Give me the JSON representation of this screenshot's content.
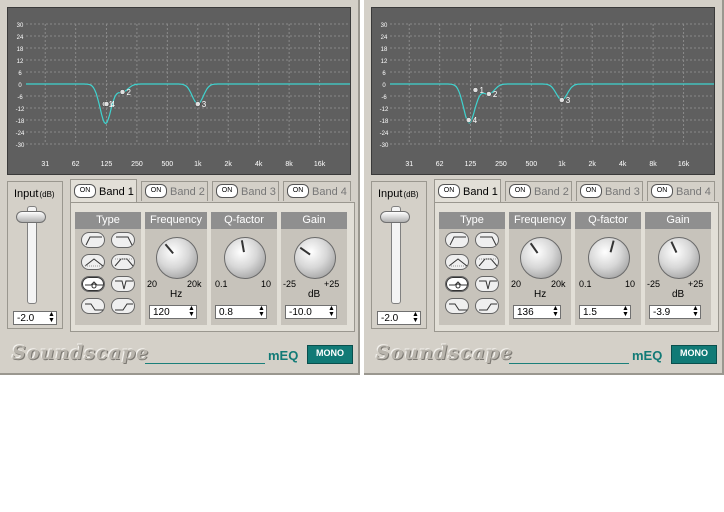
{
  "colors": {
    "accent": "#117a76",
    "curve": "#3fd3cf",
    "graph_bg": "#5f5f5f",
    "grid": "#8a8a8a"
  },
  "graph_scale": {
    "db_ticks": [
      "30",
      "24",
      "18",
      "12",
      "6",
      "0",
      "-6",
      "-12",
      "-18",
      "-24",
      "-30"
    ],
    "freq_ticks": [
      "31",
      "62",
      "125",
      "250",
      "500",
      "1k",
      "2k",
      "4k",
      "8k",
      "16k"
    ]
  },
  "panels": [
    {
      "input": {
        "label": "Input",
        "unit": "(dB)",
        "value": "-2.0"
      },
      "tabs": [
        {
          "on": "ON",
          "label": "Band 1",
          "active": true
        },
        {
          "on": "ON",
          "label": "Band 2",
          "active": false
        },
        {
          "on": "ON",
          "label": "Band 3",
          "active": false
        },
        {
          "on": "ON",
          "label": "Band 4",
          "active": false
        }
      ],
      "columns": {
        "type": "Type",
        "frequency": "Frequency",
        "q": "Q-factor",
        "gain": "Gain"
      },
      "frequency": {
        "min": "20",
        "max": "20k",
        "unit": "Hz",
        "value": "120"
      },
      "q": {
        "min": "0.1",
        "max": "10",
        "value": "0.8"
      },
      "gain": {
        "min": "-25",
        "max": "+25",
        "unit": "dB",
        "value": "-10.0"
      },
      "band_markers": [
        {
          "label": "1",
          "freq_hz": 120,
          "gain_db": -10
        },
        {
          "label": "4",
          "freq_hz": 125,
          "gain_db": -10
        },
        {
          "label": "2",
          "freq_hz": 180,
          "gain_db": -4
        },
        {
          "label": "3",
          "freq_hz": 1000,
          "gain_db": -10
        }
      ],
      "brand": {
        "logo": "Soundscape",
        "product": "mEQ",
        "mode": "MONO"
      }
    },
    {
      "input": {
        "label": "Input",
        "unit": "(dB)",
        "value": "-2.0"
      },
      "tabs": [
        {
          "on": "ON",
          "label": "Band 1",
          "active": true
        },
        {
          "on": "ON",
          "label": "Band 2",
          "active": false
        },
        {
          "on": "ON",
          "label": "Band 3",
          "active": false
        },
        {
          "on": "ON",
          "label": "Band 4",
          "active": false
        }
      ],
      "columns": {
        "type": "Type",
        "frequency": "Frequency",
        "q": "Q-factor",
        "gain": "Gain"
      },
      "frequency": {
        "min": "20",
        "max": "20k",
        "unit": "Hz",
        "value": "136"
      },
      "q": {
        "min": "0.1",
        "max": "10",
        "value": "1.5"
      },
      "gain": {
        "min": "-25",
        "max": "+25",
        "unit": "dB",
        "value": "-3.9"
      },
      "band_markers": [
        {
          "label": "1",
          "freq_hz": 140,
          "gain_db": -3
        },
        {
          "label": "2",
          "freq_hz": 190,
          "gain_db": -5
        },
        {
          "label": "3",
          "freq_hz": 1000,
          "gain_db": -8
        },
        {
          "label": "4",
          "freq_hz": 120,
          "gain_db": -18
        }
      ],
      "brand": {
        "logo": "Soundscape",
        "product": "mEQ",
        "mode": "MONO"
      }
    }
  ]
}
